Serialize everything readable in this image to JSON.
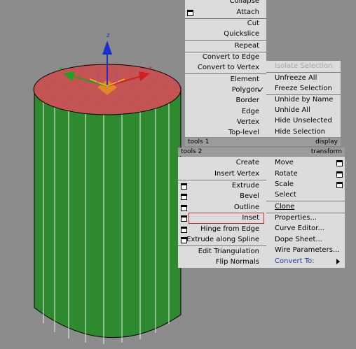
{
  "upper_menu": {
    "items": [
      "Collapse",
      "Attach",
      "Cut",
      "Quickslice",
      "Repeat",
      "Convert to Edge",
      "Convert to Vertex",
      "Element",
      "Polygon",
      "Border",
      "Edge",
      "Vertex",
      "Top-level"
    ],
    "checked_item": "Polygon"
  },
  "display_menu": {
    "items": [
      "Isolate Selection",
      "Unfreeze All",
      "Freeze Selection",
      "Unhide by Name",
      "Unhide All",
      "Hide Unselected",
      "Hide Selection"
    ],
    "disabled_item": "Isolate Selection"
  },
  "quad_labels": {
    "tools1": "tools 1",
    "display": "display",
    "tools2": "tools 2",
    "transform": "transform"
  },
  "tools2_menu": {
    "items": [
      "Create",
      "Insert Vertex",
      "Extrude",
      "Bevel",
      "Outline",
      "Inset",
      "Hinge from Edge",
      "Extrude along Spline",
      "Edit Triangulation",
      "Flip Normals"
    ],
    "highlighted_item": "Inset"
  },
  "transform_menu": {
    "items": [
      "Move",
      "Rotate",
      "Scale",
      "Select",
      "Clone",
      "Properties...",
      "Curve Editor...",
      "Dope Sheet...",
      "Wire Parameters...",
      "Convert To:"
    ]
  },
  "gizmo": {
    "z_label": "z",
    "x_label": "x",
    "y_label": "y"
  },
  "colors": {
    "cylinder_side": "#2f8f2f",
    "cylinder_top": "#c85050",
    "menu_bg": "#dcdcdc",
    "viewport_bg": "#8c8c8c"
  }
}
